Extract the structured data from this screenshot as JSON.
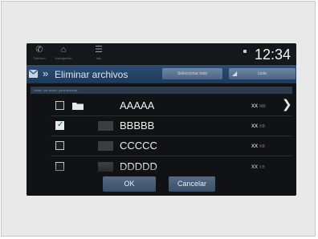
{
  "status": {
    "clock": "12:34",
    "nav": [
      {
        "label": "Teléfono",
        "icon": "phone-icon"
      },
      {
        "label": "Navegación",
        "icon": "navigation-icon"
      },
      {
        "label": "Info",
        "icon": "info-icon"
      }
    ]
  },
  "header": {
    "title": "Eliminar archivos",
    "select_all": "Seleccionar todo",
    "second_button": "Lista"
  },
  "subheader": "Selec. los archiv. para eliminar",
  "rows": [
    {
      "name": "AAAAA",
      "size": "xx",
      "unit": "MB",
      "checked": false,
      "type": "folder"
    },
    {
      "name": "BBBBB",
      "size": "xx",
      "unit": "KB",
      "checked": true,
      "type": "file"
    },
    {
      "name": "CCCCC",
      "size": "xx",
      "unit": "KB",
      "checked": false,
      "type": "file"
    },
    {
      "name": "DDDDD",
      "size": "xx",
      "unit": "KB",
      "checked": false,
      "type": "file"
    }
  ],
  "footer": {
    "ok": "OK",
    "cancel": "Cancelar"
  },
  "colors": {
    "title_bar": "#1d3a5c",
    "screen_bg": "#111214",
    "button": "#4c6584"
  }
}
